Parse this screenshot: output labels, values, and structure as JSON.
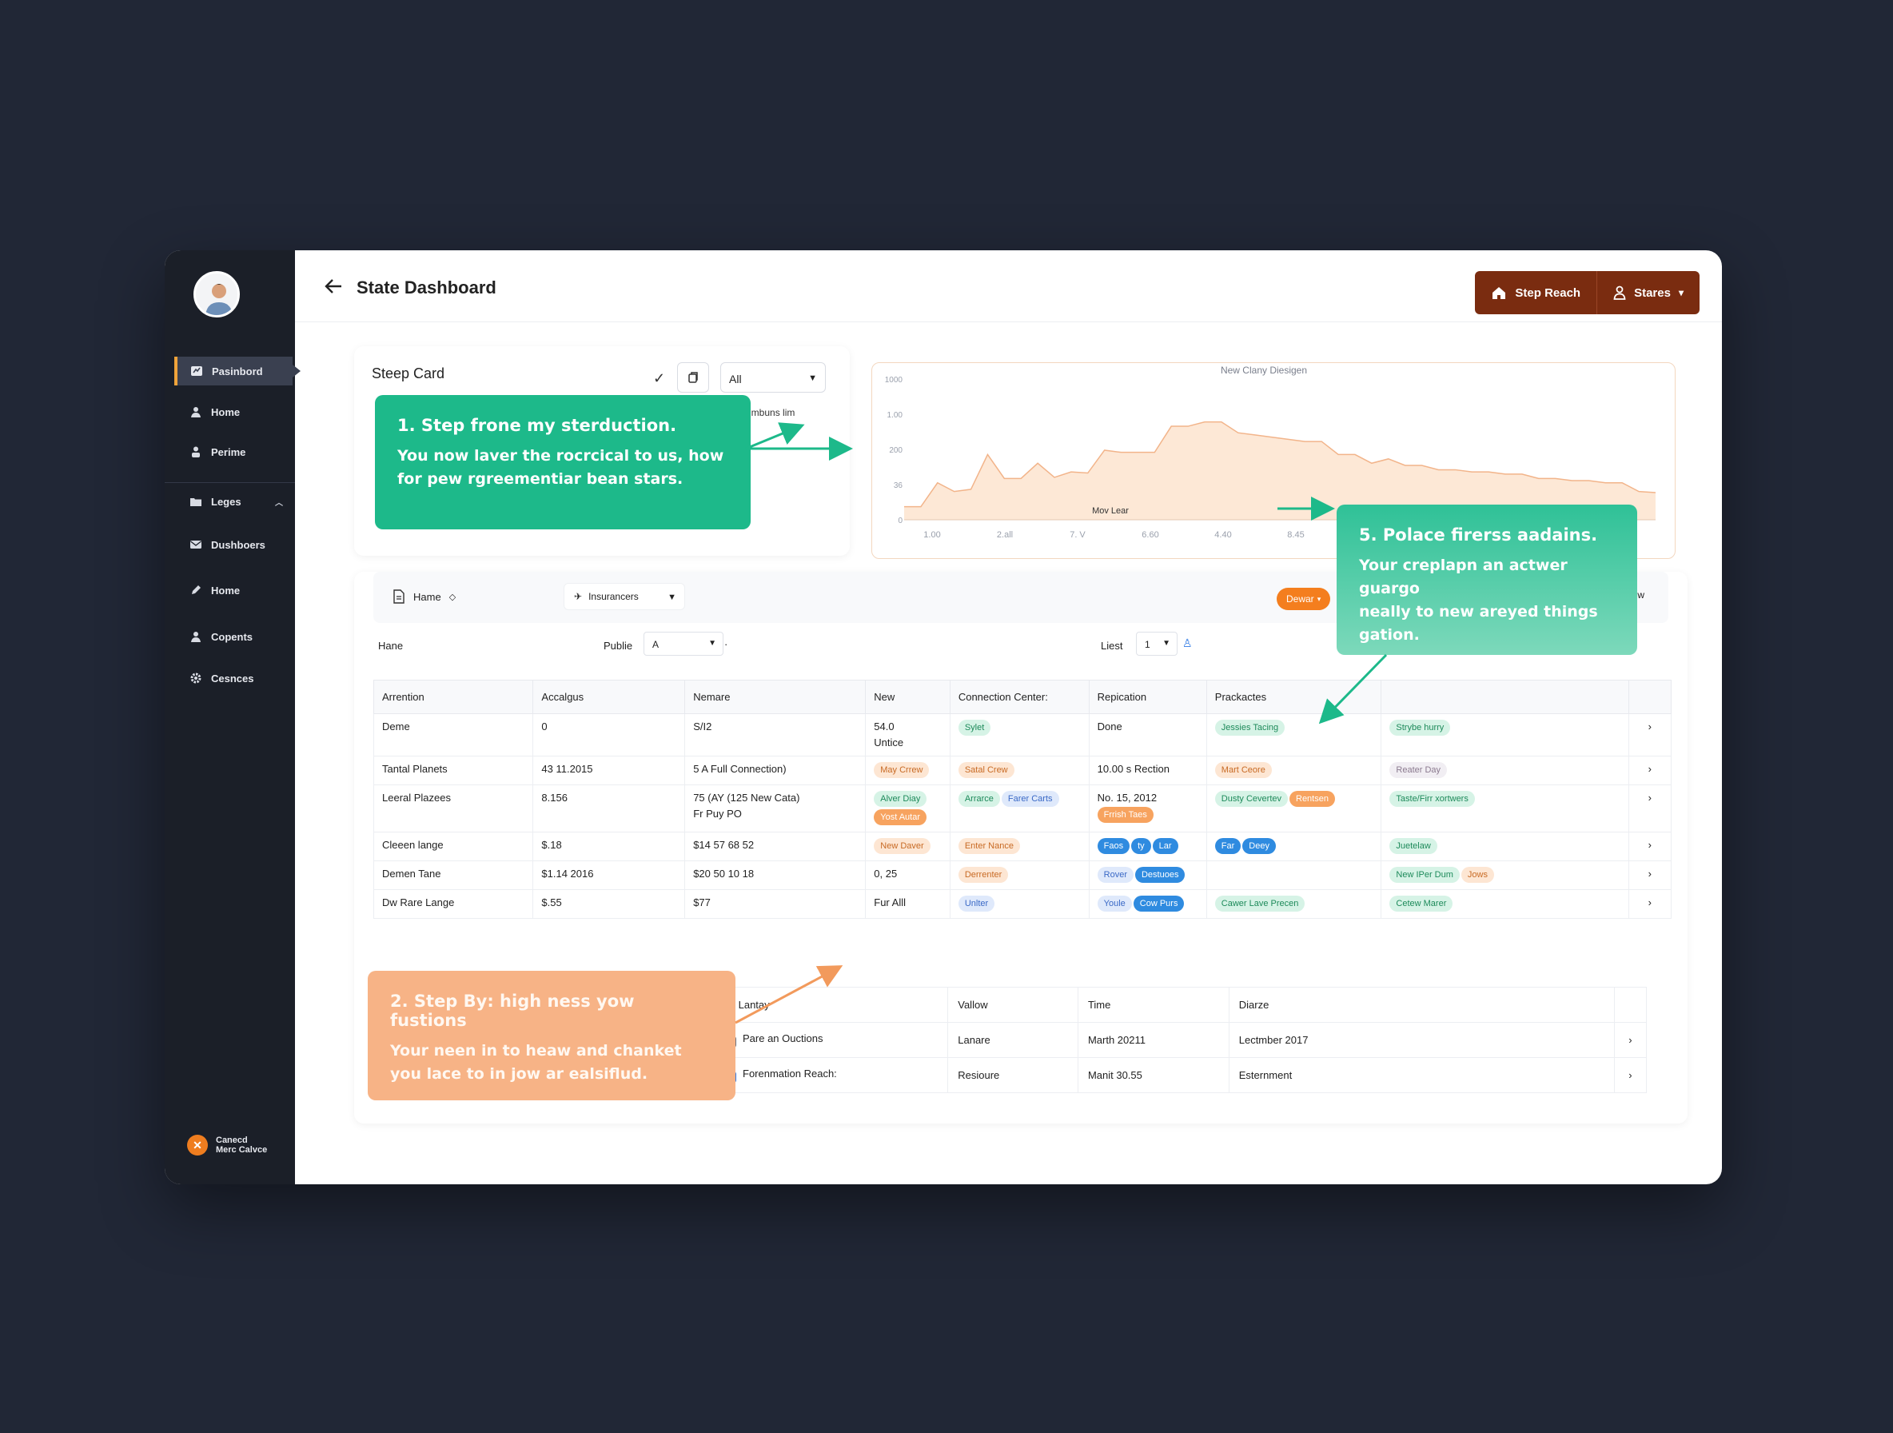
{
  "app": {
    "title": "State Dashboard",
    "header_buttons": {
      "step_reach": "Step Reach",
      "stares": "Stares"
    }
  },
  "sidebar": {
    "items": [
      {
        "label": "Pasinbord",
        "icon": "dashboard-icon",
        "active": true
      },
      {
        "label": "Home",
        "icon": "user-icon"
      },
      {
        "label": "Perime",
        "icon": "person-icon"
      },
      {
        "label": "Leges",
        "icon": "folder-icon"
      },
      {
        "label": "Dushboers",
        "icon": "mail-icon"
      },
      {
        "label": "Home",
        "icon": "pen-icon"
      },
      {
        "label": "Copents",
        "icon": "user-icon"
      },
      {
        "label": "Cesnces",
        "icon": "gear-icon"
      }
    ],
    "footer": {
      "line1": "Canecd",
      "line2": "Merc Calvce"
    }
  },
  "steep_card": {
    "title": "Steep Card",
    "select_value": "All",
    "chart_note": "day mbuns lim"
  },
  "callouts": {
    "c1": {
      "title": "1. Step frone my sterduction.",
      "body_line1": "You now laver the rocrcical to us, how",
      "body_line2": "for pew rgreementiar bean stars."
    },
    "c5": {
      "title": "5. Polace firerss aadains.",
      "body_line1": "Your creplapn an actwer guargo",
      "body_line2": "neally to new areyed things",
      "body_line3": "gation."
    },
    "c2": {
      "title": "2. Step By: high ness yow fustions",
      "body_line1": "Your neen in to heaw and chanket",
      "body_line2": "you lace to in jow ar ealsiflud."
    }
  },
  "chart_data": {
    "type": "area",
    "title": "New Clany Diesigen",
    "annotation": "Mov Lear",
    "ytick_labels": [
      "1000",
      "1.00",
      "200",
      "36",
      "0"
    ],
    "xtick_labels": [
      "1.00",
      "2.all",
      "7. V",
      "6.60",
      "4.40",
      "8.45"
    ],
    "values": [
      120,
      120,
      340,
      260,
      280,
      600,
      380,
      380,
      520,
      390,
      440,
      430,
      640,
      620,
      620,
      620,
      860,
      860,
      900,
      900,
      800,
      780,
      760,
      740,
      720,
      720,
      600,
      600,
      520,
      560,
      500,
      500,
      460,
      460,
      440,
      440,
      420,
      420,
      380,
      380,
      360,
      360,
      340,
      340,
      260,
      250
    ],
    "ylim": [
      0,
      1000
    ],
    "colors": {
      "fill": "#fde8d6",
      "line": "#f2b48a"
    }
  },
  "toolbar": {
    "home_label": "Hame",
    "insurances_label": "Insurancers",
    "dewar_label": "Dewar",
    "tail_label": "w"
  },
  "filters": {
    "hane_label": "Hane",
    "publie_label": "Publie",
    "publie_value": "A",
    "dot": "·",
    "liest_label": "Liest",
    "liest_value": "1"
  },
  "table": {
    "headers": [
      "Arrention",
      "Accalgus",
      "Nemare",
      "New",
      "Connection Center:",
      "Repication",
      "Prackactes",
      ""
    ],
    "rows": [
      {
        "c1": "Deme",
        "c2": "0",
        "c3": "S/I2",
        "c4a": "54.0",
        "c4b": "Untice",
        "pills5": [
          [
            "Sylet",
            "p-green"
          ]
        ],
        "c6": "Done",
        "pills7": [
          [
            "Jessies Tacing",
            "p-green"
          ]
        ],
        "pills8": [
          [
            "Strybe hurry",
            "p-green"
          ]
        ]
      },
      {
        "c1": "Tantal Planets",
        "c2": "43 11.2015",
        "c3": "5 A Full Connection)",
        "pills4": [
          [
            "May Crrew",
            "p-orange"
          ]
        ],
        "pills5": [
          [
            "Satal Crew",
            "p-orange"
          ]
        ],
        "c6": "10.00 s Rection",
        "pills7": [
          [
            "Mart Ceore",
            "p-orange"
          ]
        ],
        "pills8": [
          [
            "Reater Day",
            "p-grey"
          ]
        ]
      },
      {
        "c1": "Leeral Plazees",
        "c2": "8.156",
        "c3": "75 (AY (125 New Cata)",
        "c3b": "Fr Puy PO",
        "pills4": [
          [
            "Alver Diay",
            "p-green"
          ],
          [
            "Yost Autar",
            "p-solid-orange"
          ]
        ],
        "pills5": [
          [
            "Arrarce",
            "p-green"
          ],
          [
            "Farer Carts",
            "p-blue"
          ]
        ],
        "c6": "No. 15, 2012",
        "pills6": [
          [
            "Frrish Taes",
            "p-solid-orange"
          ]
        ],
        "pills7": [
          [
            "Dusty Cevertev",
            "p-green"
          ],
          [
            "Rentsen",
            "p-solid-orange"
          ]
        ],
        "pills8": [
          [
            "Taste/Firr xortwers",
            "p-green"
          ]
        ]
      },
      {
        "c1": "Cleeen lange",
        "c2": "$.18",
        "c3": "$14 57 68 52",
        "pills4": [
          [
            "New Daver",
            "p-orange"
          ]
        ],
        "pills5": [
          [
            "Enter Nance",
            "p-orange"
          ]
        ],
        "pills6": [
          [
            "Faos",
            "p-solid-blue"
          ],
          [
            "ty",
            "p-solid-blue"
          ],
          [
            "Lar",
            "p-solid-blue"
          ]
        ],
        "pills7": [
          [
            "Far",
            "p-solid-blue"
          ],
          [
            "Deey",
            "p-solid-blue"
          ]
        ],
        "pills8": [
          [
            "Juetelaw",
            "p-green"
          ]
        ]
      },
      {
        "c1": "Demen Tane",
        "c2": "$1.14 2016",
        "c3": "$20 50 10 18",
        "c4a": "0, 25",
        "pills5": [
          [
            "Derrenter",
            "p-orange"
          ]
        ],
        "pills6": [
          [
            "Rover",
            "p-blue"
          ],
          [
            "Destuoes",
            "p-solid-blue"
          ]
        ],
        "pills8": [
          [
            "New IPer Dum",
            "p-green"
          ],
          [
            "Jows",
            "p-orange"
          ]
        ]
      },
      {
        "c1": "Dw Rare Lange",
        "c2": "$.55",
        "c3": "$77",
        "c4a": "Fur Alll",
        "pills5": [
          [
            "Unlter",
            "p-blue"
          ]
        ],
        "pills6": [
          [
            "Youle",
            "p-blue"
          ],
          [
            "Cow Purs",
            "p-solid-blue"
          ]
        ],
        "pills7": [
          [
            "Cawer Lave Precen",
            "p-green"
          ]
        ],
        "pills8": [
          [
            "Cetew Marer",
            "p-green"
          ]
        ]
      }
    ]
  },
  "subtable": {
    "headers": [
      "Ar Lantay",
      "Vallow",
      "Time",
      "Diarze"
    ],
    "rows": [
      {
        "c1": "Pare an Ouctions",
        "c2": "Lanare",
        "c3": "Marth 20211",
        "c4": "Lectmber 2017",
        "checked": false
      },
      {
        "c1": "Forenmation Reach:",
        "c2": "Resioure",
        "c3": "Manit 30.55",
        "c4": "Esternment",
        "checked": true
      }
    ]
  }
}
